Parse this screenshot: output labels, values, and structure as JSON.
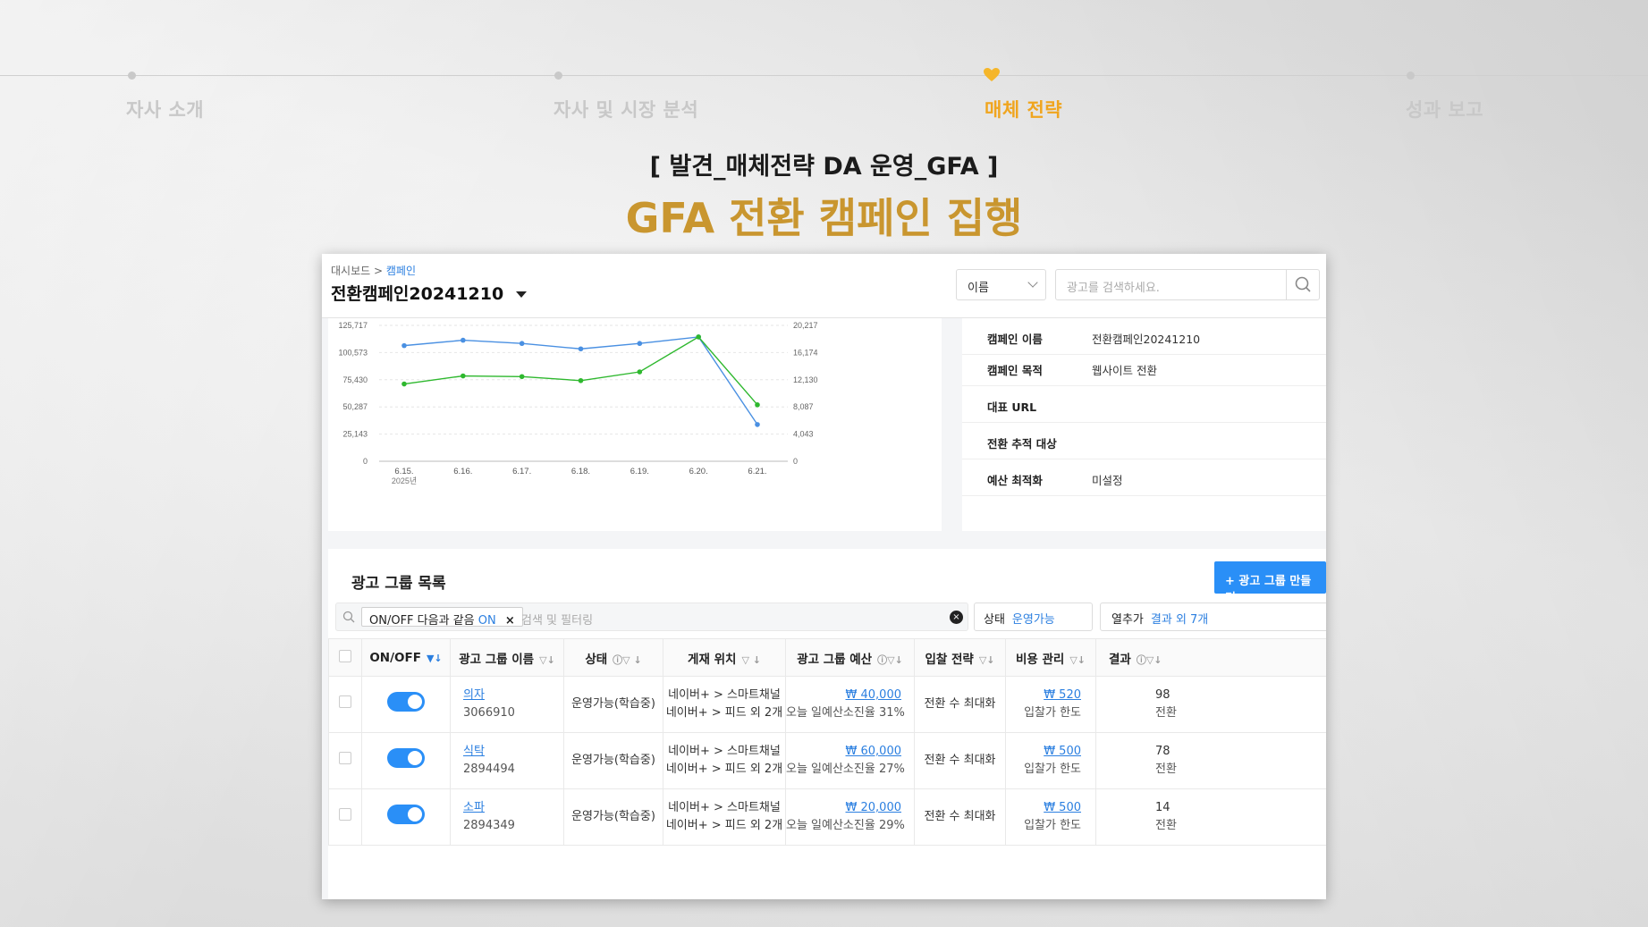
{
  "nav": {
    "steps": [
      {
        "label": "자사 소개",
        "active": false
      },
      {
        "label": "자사 및 시장 분석",
        "active": false
      },
      {
        "label": "매체 전략",
        "active": true
      },
      {
        "label": "성과 보고",
        "active": false
      }
    ],
    "accent": "#f0a51e"
  },
  "slide": {
    "subtitle": "[ 발견_매체전략 DA 운영_GFA ]",
    "title": "GFA 전환 캠페인 집행",
    "title_color": "#c9962f"
  },
  "app": {
    "breadcrumb": {
      "root": "대시보드",
      "separator": ">",
      "current": "캠페인"
    },
    "campaign_title": "전환캠페인20241210",
    "search_type": "이름",
    "search_placeholder": "광고를 검색하세요."
  },
  "chart_data": {
    "type": "line",
    "x": [
      "6.15.",
      "6.16.",
      "6.17.",
      "6.18.",
      "6.19.",
      "6.20.",
      "6.21."
    ],
    "x_sublabel": "2025년",
    "y_left_ticks": [
      "0",
      "25,143",
      "50,287",
      "75,430",
      "100,573",
      "125,717"
    ],
    "y_right_ticks": [
      "0",
      "4,043",
      "8,087",
      "12,130",
      "16,174",
      "20,217"
    ],
    "ylim_left": [
      0,
      125717
    ],
    "ylim_right": [
      0,
      20217
    ],
    "series": [
      {
        "color": "#4a90e2",
        "axis": "left",
        "values": [
          107000,
          112000,
          109000,
          104000,
          109000,
          115000,
          34000
        ]
      },
      {
        "color": "#2eb82e",
        "axis": "right",
        "values": [
          11500,
          12700,
          12600,
          12000,
          13300,
          18500,
          8400
        ]
      }
    ],
    "grid": true
  },
  "campaign_info": [
    {
      "key": "캠페인 이름",
      "value": "전환캠페인20241210"
    },
    {
      "key": "캠페인 목적",
      "value": "웹사이트 전환"
    },
    {
      "key": "대표 URL",
      "value": ""
    },
    {
      "key": "전환 추적 대상",
      "value": ""
    },
    {
      "key": "예산 최적화",
      "value": "미설정"
    }
  ],
  "adgroups": {
    "title": "광고 그룹 목록",
    "create_button": "+ 광고 그룹 만들기",
    "filter_chip": {
      "text": "ON/OFF 다음과 같음",
      "value": "ON",
      "close": "×"
    },
    "filter_placeholder": "검색 및 필터링",
    "clear_icon": "×",
    "state_filter": {
      "label": "상태",
      "value": "운영가능"
    },
    "columns_filter": {
      "label": "열추가",
      "value": "결과 외 7개"
    },
    "columns": [
      "ON/OFF",
      "광고 그룹 이름",
      "상태",
      "게재 위치",
      "광고 그룹 예산",
      "입찰 전략",
      "비용 관리",
      "결과"
    ],
    "rows": [
      {
        "name": "의자",
        "id": "3066910",
        "on": true,
        "status": "운영가능(학습중)",
        "placement1": "네이버+ > 스마트채널",
        "placement2": "네이버+ > 피드 외 2개",
        "budget": "₩ 40,000",
        "budget_note": "오늘 일예산소진율 31%",
        "bid": "전환 수 최대화",
        "cost": "₩ 520",
        "cost_note": "입찰가 한도",
        "result": "98",
        "result_note": "전환"
      },
      {
        "name": "식탁",
        "id": "2894494",
        "on": true,
        "status": "운영가능(학습중)",
        "placement1": "네이버+ > 스마트채널",
        "placement2": "네이버+ > 피드 외 2개",
        "budget": "₩ 60,000",
        "budget_note": "오늘 일예산소진율 27%",
        "bid": "전환 수 최대화",
        "cost": "₩ 500",
        "cost_note": "입찰가 한도",
        "result": "78",
        "result_note": "전환"
      },
      {
        "name": "소파",
        "id": "2894349",
        "on": true,
        "status": "운영가능(학습중)",
        "placement1": "네이버+ > 스마트채널",
        "placement2": "네이버+ > 피드 외 2개",
        "budget": "₩ 20,000",
        "budget_note": "오늘 일예산소진율 29%",
        "bid": "전환 수 최대화",
        "cost": "₩ 500",
        "cost_note": "입찰가 한도",
        "result": "14",
        "result_note": "전환"
      }
    ]
  }
}
